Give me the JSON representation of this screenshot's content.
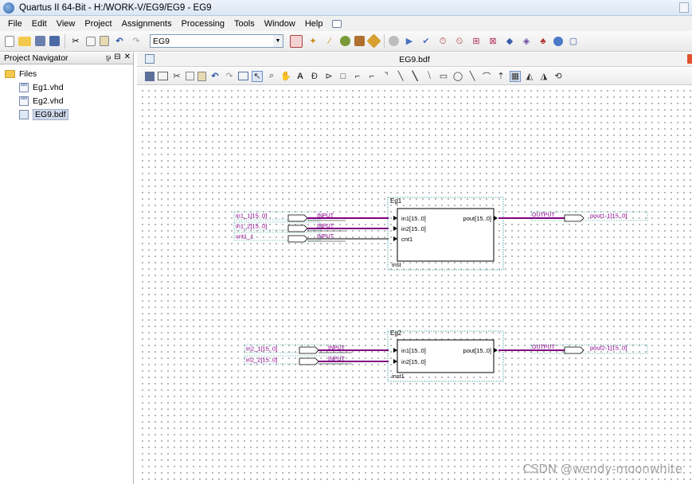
{
  "window": {
    "title": "Quartus II 64-Bit - H:/WORK-V/EG9/EG9 - EG9"
  },
  "menu": [
    "File",
    "Edit",
    "View",
    "Project",
    "Assignments",
    "Processing",
    "Tools",
    "Window",
    "Help"
  ],
  "toolbar": {
    "entity_combo_value": "EG9"
  },
  "navigator": {
    "title": "Project Navigator",
    "header_controls": [
      "⅌",
      "⊟",
      "✕"
    ],
    "root": "Files",
    "files": [
      {
        "name": "Eg1.vhd",
        "icon": "vhd-file-icon",
        "selected": false
      },
      {
        "name": "Eg2.vhd",
        "icon": "vhd-file-icon",
        "selected": false
      },
      {
        "name": "EG9.bdf",
        "icon": "bdf-file-icon",
        "selected": true
      }
    ]
  },
  "document": {
    "tab_title": "EG9.bdf"
  },
  "schematic": {
    "blocks": [
      {
        "title": "Eg1",
        "instance": "inst",
        "ports_in": [
          "in1[15..0]",
          "in2[15..0]",
          "cnt1"
        ],
        "port_out": "pout[15..0]",
        "inputs": [
          {
            "name": "in1_1[15..0]",
            "type": "INPUT",
            "bus": true
          },
          {
            "name": "in1_2[15..0]",
            "type": "INPUT",
            "bus": true
          },
          {
            "name": "cnt1_1",
            "type": "INPUT",
            "bus": false
          }
        ],
        "output": {
          "name": "pout1-1[15..0]",
          "type": "OUTPUT"
        }
      },
      {
        "title": "Eg2",
        "instance": "inst1",
        "ports_in": [
          "in1[15..0]",
          "in2[15..0]"
        ],
        "port_out": "pout[15..0]",
        "inputs": [
          {
            "name": "in2_1[15..0]",
            "type": "INPUT",
            "bus": true
          },
          {
            "name": "in2_2[15..0]",
            "type": "INPUT",
            "bus": true
          }
        ],
        "output": {
          "name": "pout2-1[15..0]",
          "type": "OUTPUT"
        }
      }
    ]
  },
  "watermark": "CSDN @wendy-moonwhite",
  "colors": {
    "bus_wire": "#800080",
    "pin_label": "#8a008a",
    "frame": "#1b8a8a"
  }
}
